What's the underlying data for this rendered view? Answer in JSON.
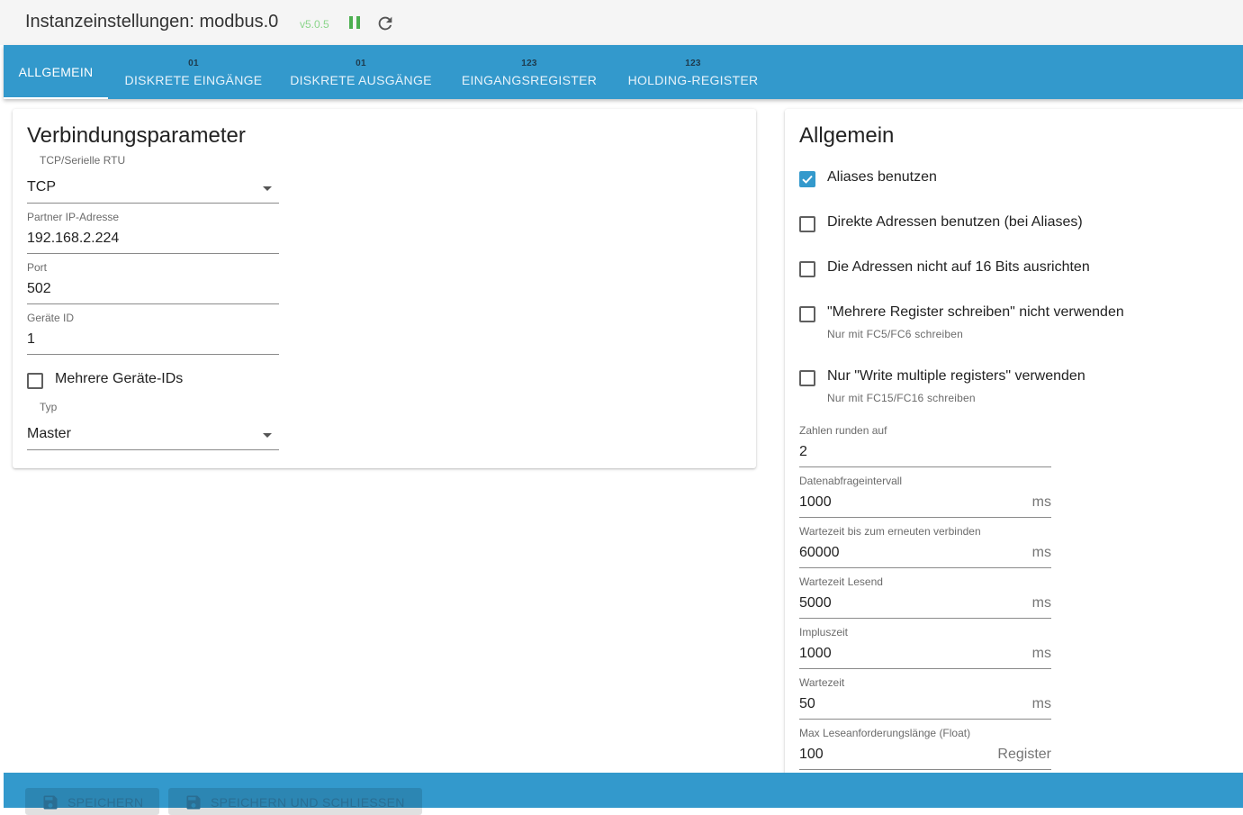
{
  "header": {
    "title": "Instanzeinstellungen: modbus.0",
    "version": "v5.0.5"
  },
  "tabs": [
    {
      "badge": "",
      "label": "ALLGEMEIN"
    },
    {
      "badge": "01",
      "label": "DISKRETE EINGÄNGE"
    },
    {
      "badge": "01",
      "label": "DISKRETE AUSGÄNGE"
    },
    {
      "badge": "123",
      "label": "EINGANGSREGISTER"
    },
    {
      "badge": "123",
      "label": "HOLDING-REGISTER"
    }
  ],
  "connection": {
    "title": "Verbindungsparameter",
    "type_label": "TCP/Serielle RTU",
    "type_value": "TCP",
    "ip_label": "Partner IP-Adresse",
    "ip_value": "192.168.2.224",
    "port_label": "Port",
    "port_value": "502",
    "device_label": "Geräte ID",
    "device_value": "1",
    "multi_ids_label": "Mehrere Geräte-IDs",
    "multi_ids_checked": false,
    "role_label": "Typ",
    "role_value": "Master"
  },
  "general": {
    "title": "Allgemein",
    "checkboxes": [
      {
        "label": "Aliases benutzen",
        "checked": true,
        "help": ""
      },
      {
        "label": "Direkte Adressen benutzen (bei Aliases)",
        "checked": false,
        "help": ""
      },
      {
        "label": "Die Adressen nicht auf 16 Bits ausrichten",
        "checked": false,
        "help": ""
      },
      {
        "label": "\"Mehrere Register schreiben\" nicht verwenden",
        "checked": false,
        "help": "Nur mit FC5/FC6 schreiben"
      },
      {
        "label": "Nur \"Write multiple registers\" verwenden",
        "checked": false,
        "help": "Nur mit FC15/FC16 schreiben"
      }
    ],
    "fields": [
      {
        "label": "Zahlen runden auf",
        "value": "2",
        "unit": ""
      },
      {
        "label": "Datenabfrageintervall",
        "value": "1000",
        "unit": "ms"
      },
      {
        "label": "Wartezeit bis zum erneuten verbinden",
        "value": "60000",
        "unit": "ms"
      },
      {
        "label": "Wartezeit Lesend",
        "value": "5000",
        "unit": "ms"
      },
      {
        "label": "Impluszeit",
        "value": "1000",
        "unit": "ms"
      },
      {
        "label": "Wartezeit",
        "value": "50",
        "unit": "ms"
      },
      {
        "label": "Max Leseanforderungslänge (Float)",
        "value": "100",
        "unit": "Register"
      }
    ]
  },
  "footer": {
    "save_label": "SPEICHERN",
    "save_close_label": "SPEICHERN UND SCHLIESSEN"
  },
  "colors": {
    "accent": "#3399cc",
    "version": "#8bd58b",
    "pause": "#4caf50"
  },
  "icons": [
    "pause-icon",
    "reload-icon",
    "dropdown-caret-icon",
    "checkmark-icon",
    "save-icon"
  ]
}
